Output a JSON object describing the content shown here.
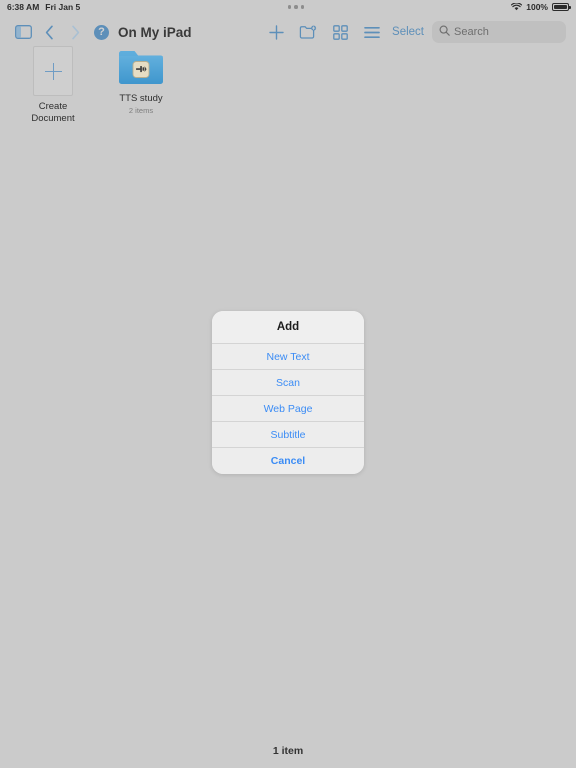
{
  "status_bar": {
    "time": "6:38 AM",
    "date": "Fri Jan 5",
    "battery_percent": "100%",
    "wifi_icon": "wifi-icon",
    "battery_icon": "battery-icon",
    "multitask_icon": "multitasking-dots-icon"
  },
  "navbar": {
    "sidebar_icon": "sidebar-toggle-icon",
    "back_icon": "chevron-left-icon",
    "forward_icon": "chevron-right-icon",
    "help_icon": "question-mark-circle-icon",
    "help_label": "?",
    "title": "On My iPad",
    "add_icon": "plus-icon",
    "new_folder_icon": "new-folder-icon",
    "grid_view_icon": "grid-view-icon",
    "list_view_icon": "list-view-icon",
    "select_label": "Select",
    "search_icon": "search-icon",
    "search_placeholder": "Search",
    "search_value": ""
  },
  "files": [
    {
      "name": "Create\nDocument",
      "label_line1": "Create",
      "label_line2": "Document",
      "subtitle": "",
      "type": "create-document-placeholder",
      "icon": "plus-icon"
    },
    {
      "name": "TTS study",
      "label_line1": "TTS study",
      "label_line2": "",
      "subtitle": "2 items",
      "type": "folder",
      "icon": "folder-with-audio-waveform-icon"
    }
  ],
  "bottom_bar": {
    "item_count": "1 item"
  },
  "dialog": {
    "title": "Add",
    "options": [
      {
        "label": "New Text"
      },
      {
        "label": "Scan"
      },
      {
        "label": "Web Page"
      },
      {
        "label": "Subtitle"
      }
    ],
    "cancel_label": "Cancel"
  },
  "colors": {
    "background": "#cbcbcb",
    "accent_blue": "#3b8cf5",
    "toolbar_blue": "#5d8fb9",
    "folder_blue": "#4a9fd4",
    "sheet_bg": "#ececec",
    "text_dark": "#2f2f2f"
  }
}
